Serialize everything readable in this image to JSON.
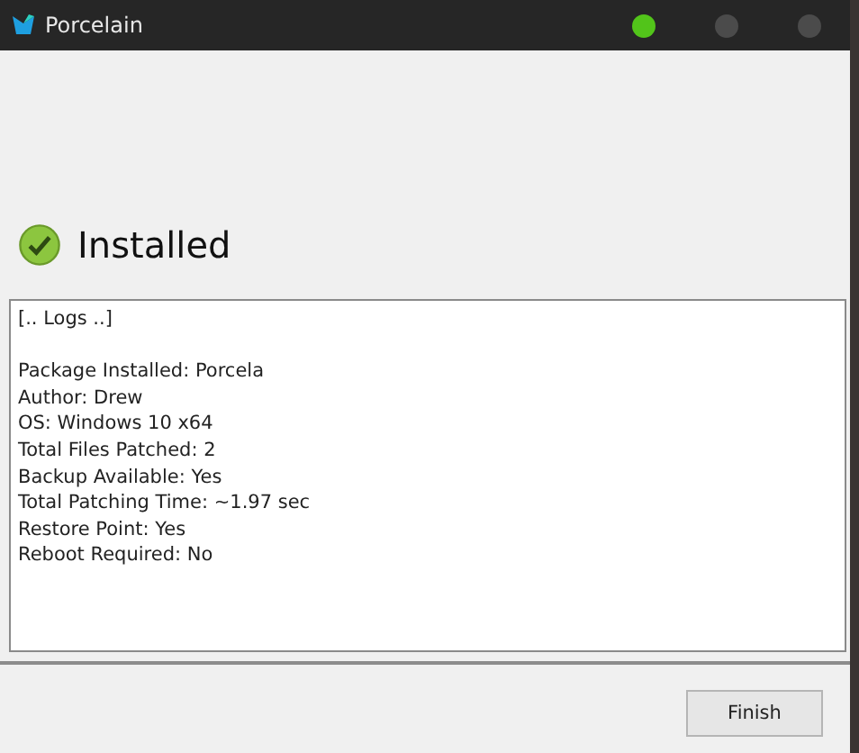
{
  "window": {
    "title": "Porcelain",
    "controls": [
      {
        "color": "#52c41a"
      },
      {
        "color": "#4b4b4b"
      },
      {
        "color": "#4b4b4b"
      }
    ]
  },
  "status": {
    "kind": "success",
    "text": "Installed"
  },
  "log": {
    "header": "[.. Logs ..]",
    "lines": [
      "Package Installed: Porcela",
      "Author: Drew",
      "OS: Windows 10 x64",
      "Total Files Patched: 2",
      "Backup Available: Yes",
      "Total Patching Time: ~1.97 sec",
      "Restore Point: Yes",
      "Reboot Required: No"
    ]
  },
  "buttons": [
    "Finish"
  ]
}
